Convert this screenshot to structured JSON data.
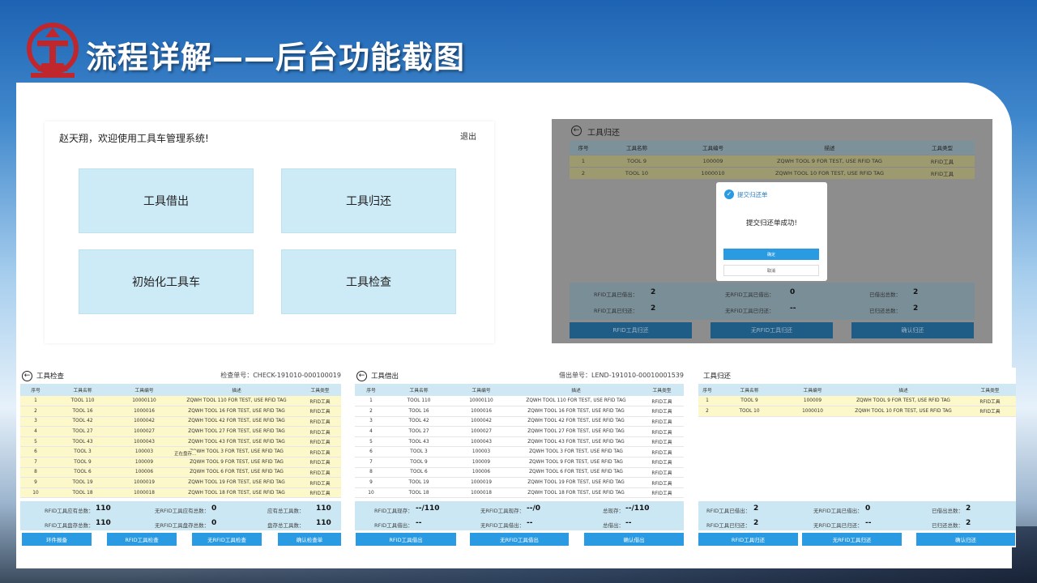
{
  "slide": {
    "title": "流程详解——后台功能截图"
  },
  "home": {
    "welcome": "赵天翔，欢迎使用工具车管理系统!",
    "logout": "退出",
    "tiles": [
      "工具借出",
      "工具归还",
      "初始化工具车",
      "工具检查"
    ]
  },
  "return_dialog_screen": {
    "header": "工具归还",
    "columns": [
      "序号",
      "工具名称",
      "工具编号",
      "描述",
      "工具类型"
    ],
    "rows": [
      [
        "1",
        "TOOL 9",
        "100009",
        "ZQWH TOOL 9 FOR TEST, USE RFID TAG",
        "RFID工具"
      ],
      [
        "2",
        "TOOL 10",
        "1000010",
        "ZQWH TOOL 10 FOR TEST, USE RFID TAG",
        "RFID工具"
      ]
    ],
    "modal": {
      "title": "提交归还单",
      "message": "提交归还单成功!",
      "confirm": "确定",
      "cancel": "取消"
    },
    "summary": [
      [
        "RFID工具已借出：",
        "2",
        "无RFID工具已借出：",
        "0",
        "已借出总数：",
        "2"
      ],
      [
        "RFID工具已归还：",
        "2",
        "无RFID工具已归还：",
        "--",
        "已归还总数：",
        "2"
      ]
    ],
    "buttons": [
      "RFID工具归还",
      "无RFID工具归还",
      "确认归还"
    ]
  },
  "check_screen": {
    "header": "工具检查",
    "order_label": "检查单号：",
    "order_no": "CHECK-191010-000100019",
    "columns": [
      "序号",
      "工具名称",
      "工具编号",
      "描述",
      "工具类型"
    ],
    "rows": [
      [
        "1",
        "TOOL 110",
        "10000110",
        "ZQWH TOOL 110 FOR TEST, USE RFID TAG",
        "RFID工具"
      ],
      [
        "2",
        "TOOL 16",
        "1000016",
        "ZQWH TOOL 16 FOR TEST, USE RFID TAG",
        "RFID工具"
      ],
      [
        "3",
        "TOOL 42",
        "1000042",
        "ZQWH TOOL 42 FOR TEST, USE RFID TAG",
        "RFID工具"
      ],
      [
        "4",
        "TOOL 27",
        "1000027",
        "ZQWH TOOL 27 FOR TEST, USE RFID TAG",
        "RFID工具"
      ],
      [
        "5",
        "TOOL 43",
        "1000043",
        "ZQWH TOOL 43 FOR TEST, USE RFID TAG",
        "RFID工具"
      ],
      [
        "6",
        "TOOL 3",
        "100003",
        "ZQWH TOOL 3 FOR TEST, USE RFID TAG",
        "RFID工具"
      ],
      [
        "7",
        "TOOL 9",
        "100009",
        "ZQWH TOOL 9 FOR TEST, USE RFID TAG",
        "RFID工具"
      ],
      [
        "8",
        "TOOL 6",
        "100006",
        "ZQWH TOOL 6 FOR TEST, USE RFID TAG",
        "RFID工具"
      ],
      [
        "9",
        "TOOL 19",
        "1000019",
        "ZQWH TOOL 19 FOR TEST, USE RFID TAG",
        "RFID工具"
      ],
      [
        "10",
        "TOOL 18",
        "1000018",
        "ZQWH TOOL 18 FOR TEST, USE RFID TAG",
        "RFID工具"
      ]
    ],
    "overlay_text": "正在盘存...",
    "summary": [
      [
        "RFID工具应有总数：",
        "110",
        "无RFID工具应有总数：",
        "0",
        "应有总工具数：",
        "110"
      ],
      [
        "RFID工具盘存总数：",
        "110",
        "无RFID工具盘存总数：",
        "0",
        "盘存总工具数：",
        "110"
      ]
    ],
    "buttons": [
      "环件报备",
      "RFID工具检查",
      "无RFID工具检查",
      "确认检查单"
    ]
  },
  "lend_screen": {
    "header": "工具借出",
    "order_label": "借出单号：",
    "order_no": "LEND-191010-00010001539",
    "columns": [
      "序号",
      "工具名称",
      "工具编号",
      "描述",
      "工具类型"
    ],
    "rows": [
      [
        "1",
        "TOOL 110",
        "10000110",
        "ZQWH TOOL 110 FOR TEST, USE RFID TAG",
        "RFID工具"
      ],
      [
        "2",
        "TOOL 16",
        "1000016",
        "ZQWH TOOL 16 FOR TEST, USE RFID TAG",
        "RFID工具"
      ],
      [
        "3",
        "TOOL 42",
        "1000042",
        "ZQWH TOOL 42 FOR TEST, USE RFID TAG",
        "RFID工具"
      ],
      [
        "4",
        "TOOL 27",
        "1000027",
        "ZQWH TOOL 27 FOR TEST, USE RFID TAG",
        "RFID工具"
      ],
      [
        "5",
        "TOOL 43",
        "1000043",
        "ZQWH TOOL 43 FOR TEST, USE RFID TAG",
        "RFID工具"
      ],
      [
        "6",
        "TOOL 3",
        "100003",
        "ZQWH TOOL 3 FOR TEST, USE RFID TAG",
        "RFID工具"
      ],
      [
        "7",
        "TOOL 9",
        "100009",
        "ZQWH TOOL 9 FOR TEST, USE RFID TAG",
        "RFID工具"
      ],
      [
        "8",
        "TOOL 6",
        "100006",
        "ZQWH TOOL 6 FOR TEST, USE RFID TAG",
        "RFID工具"
      ],
      [
        "9",
        "TOOL 19",
        "1000019",
        "ZQWH TOOL 19 FOR TEST, USE RFID TAG",
        "RFID工具"
      ],
      [
        "10",
        "TOOL 18",
        "1000018",
        "ZQWH TOOL 18 FOR TEST, USE RFID TAG",
        "RFID工具"
      ]
    ],
    "summary": [
      [
        "RFID工具现存：",
        "--/110",
        "无RFID工具现存：",
        "--/0",
        "总现存：",
        "--/110"
      ],
      [
        "RFID工具借出：",
        "--",
        "无RFID工具借出：",
        "--",
        "总借出：",
        "--"
      ]
    ],
    "buttons": [
      "RFID工具借出",
      "无RFID工具借出",
      "确认借出"
    ]
  },
  "return_screen": {
    "header": "工具归还",
    "columns": [
      "序号",
      "工具名称",
      "工具编号",
      "描述",
      "工具类型"
    ],
    "rows": [
      [
        "1",
        "TOOL 9",
        "100009",
        "ZQWH TOOL 9 FOR TEST, USE RFID TAG",
        "RFID工具"
      ],
      [
        "2",
        "TOOL 10",
        "1000010",
        "ZQWH TOOL 10 FOR TEST, USE RFID TAG",
        "RFID工具"
      ]
    ],
    "summary": [
      [
        "RFID工具已借出：",
        "2",
        "无RFID工具已借出：",
        "0",
        "已借出总数：",
        "2"
      ],
      [
        "RFID工具已归还：",
        "2",
        "无RFID工具已归还：",
        "--",
        "已归还总数：",
        "2"
      ]
    ],
    "buttons": [
      "RFID工具归还",
      "无RFID工具归还",
      "确认归还"
    ]
  },
  "colors": {
    "accent_blue": "#2a9be2",
    "tile_blue": "#cdebf6",
    "row_yellow": "#fdf8c9",
    "logo_red": "#c0272d"
  },
  "icons": [
    "railway-logo-icon",
    "back-arrow-icon",
    "info-icon"
  ]
}
